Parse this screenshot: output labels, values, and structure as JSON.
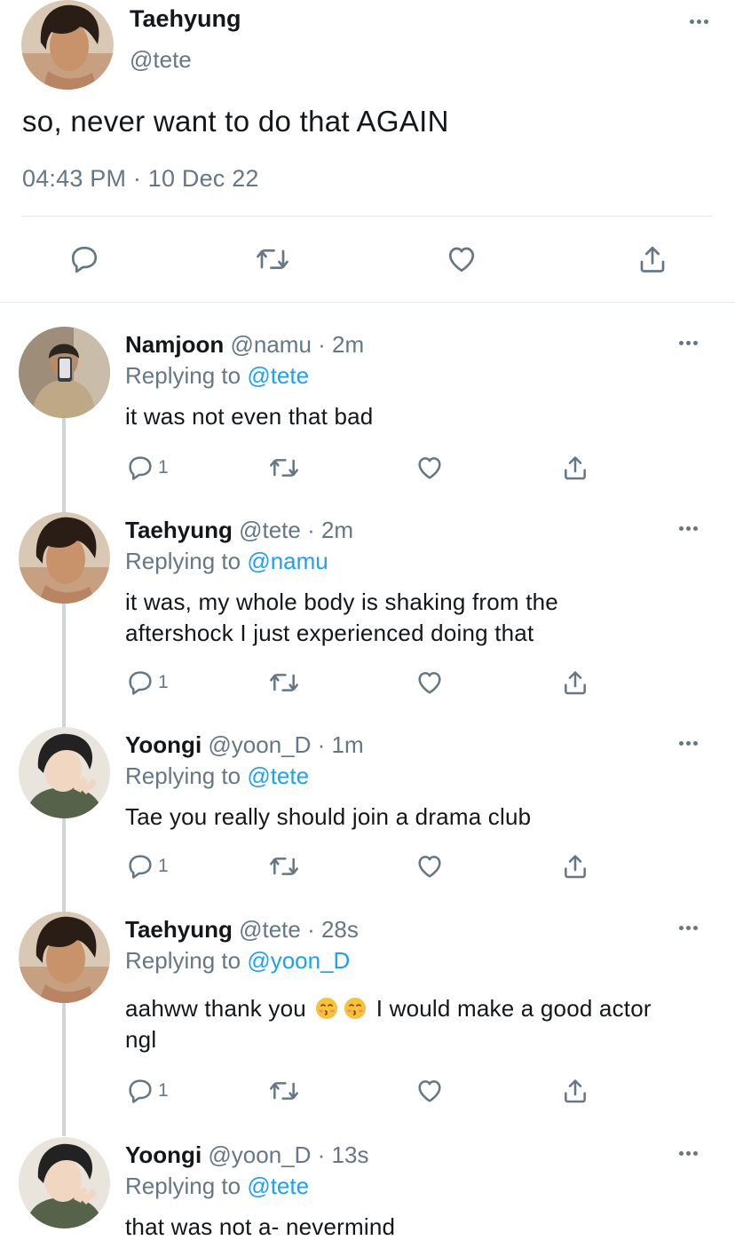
{
  "main_tweet": {
    "name": "Taehyung",
    "handle": "@tete",
    "text": "so, never want to do that AGAIN",
    "timestamp": "04:43 PM · 10 Dec 22",
    "icons": [
      "reply-icon",
      "retweet-icon",
      "like-icon",
      "share-icon"
    ]
  },
  "replies": [
    {
      "name": "Namjoon",
      "meta": "@namu · 2m",
      "replying_prefix": "Replying to ",
      "replying_to": "@tete",
      "text": "it was not even that bad",
      "reply_count": "1",
      "avatar": "namjoon-avatar"
    },
    {
      "name": "Taehyung",
      "meta": "@tete · 2m",
      "replying_prefix": "Replying to ",
      "replying_to": "@namu",
      "text": "it was, my whole body is shaking from the aftershock I just experienced doing that",
      "reply_count": "1",
      "avatar": "taehyung-avatar"
    },
    {
      "name": "Yoongi",
      "meta": "@yoon_D · 1m",
      "replying_prefix": "Replying to ",
      "replying_to": "@tete",
      "text": "Tae you really should join a drama club",
      "reply_count": "1",
      "avatar": "yoongi-avatar"
    },
    {
      "name": "Taehyung",
      "meta": "@tete · 28s",
      "replying_prefix": "Replying to ",
      "replying_to": "@yoon_D",
      "text_before_emoji": "aahww thank you",
      "emojis": [
        "kissing-face-emoji",
        "kissing-face-emoji"
      ],
      "text_after_emoji": "I would make a good actor ngl",
      "reply_count": "1",
      "avatar": "taehyung-avatar"
    },
    {
      "name": "Yoongi",
      "meta": "@yoon_D · 13s",
      "replying_prefix": "Replying to ",
      "replying_to": "@tete",
      "text": "that was not a- nevermind",
      "avatar": "yoongi-avatar"
    }
  ],
  "colors": {
    "text": "#14171a",
    "secondary": "#657786",
    "link": "#1da1f2",
    "divider": "#e1e8ed",
    "thread_line": "#ccd6dd"
  }
}
